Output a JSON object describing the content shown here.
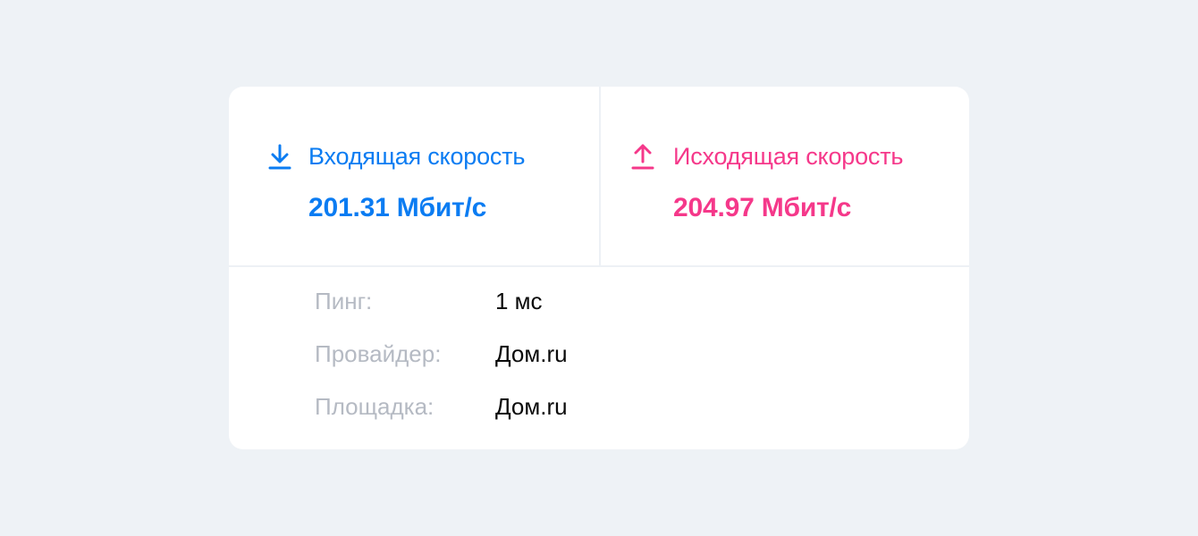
{
  "colors": {
    "background": "#eef2f6",
    "card": "#ffffff",
    "download_accent": "#0b7cf2",
    "upload_accent": "#f5388a",
    "muted_label": "#b5bac3",
    "value_text": "#0b0b0b"
  },
  "download": {
    "icon": "download-arrow-icon",
    "label": "Входящая скорость",
    "value": "201.31 Мбит/с"
  },
  "upload": {
    "icon": "upload-arrow-icon",
    "label": "Исходящая скорость",
    "value": "204.97 Мбит/с"
  },
  "details": [
    {
      "key": "Пинг:",
      "value": "1 мс"
    },
    {
      "key": "Провайдер:",
      "value": "Дом.ru"
    },
    {
      "key": "Площадка:",
      "value": "Дом.ru"
    }
  ]
}
